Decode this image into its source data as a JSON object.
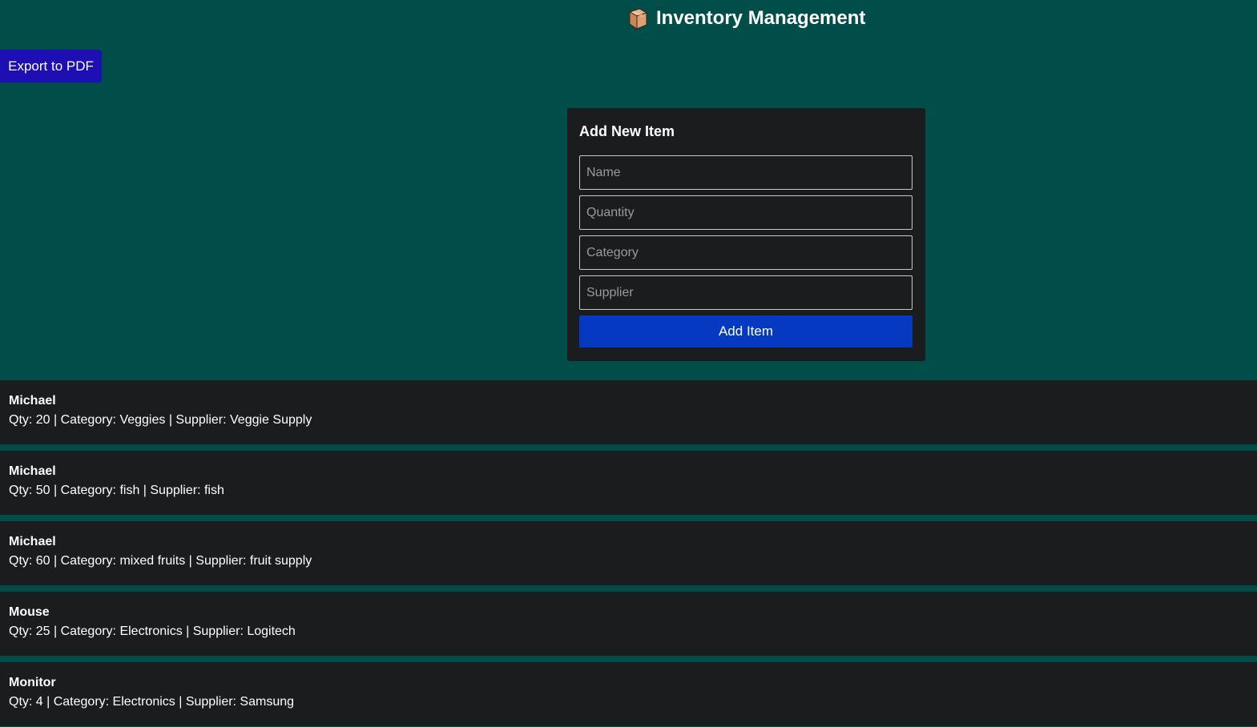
{
  "header": {
    "title": "Inventory Management",
    "icon": "package-box-icon"
  },
  "toolbar": {
    "export_label": "Export to PDF"
  },
  "form": {
    "title": "Add New Item",
    "name_placeholder": "Name",
    "quantity_placeholder": "Quantity",
    "category_placeholder": "Category",
    "supplier_placeholder": "Supplier",
    "submit_label": "Add Item"
  },
  "items": [
    {
      "name": "Michael",
      "meta": "Qty: 20 | Category: Veggies | Supplier: Veggie Supply"
    },
    {
      "name": "Michael",
      "meta": "Qty: 50 | Category: fish | Supplier: fish"
    },
    {
      "name": "Michael",
      "meta": "Qty: 60 | Category: mixed fruits | Supplier: fruit supply"
    },
    {
      "name": "Mouse",
      "meta": "Qty: 25 | Category: Electronics | Supplier: Logitech"
    },
    {
      "name": "Monitor",
      "meta": "Qty: 4 | Category: Electronics | Supplier: Samsung"
    }
  ],
  "colors": {
    "background": "#004d4a",
    "card": "#1b1c1e",
    "export_button": "#1d0fb3",
    "add_button": "#0639c2"
  }
}
